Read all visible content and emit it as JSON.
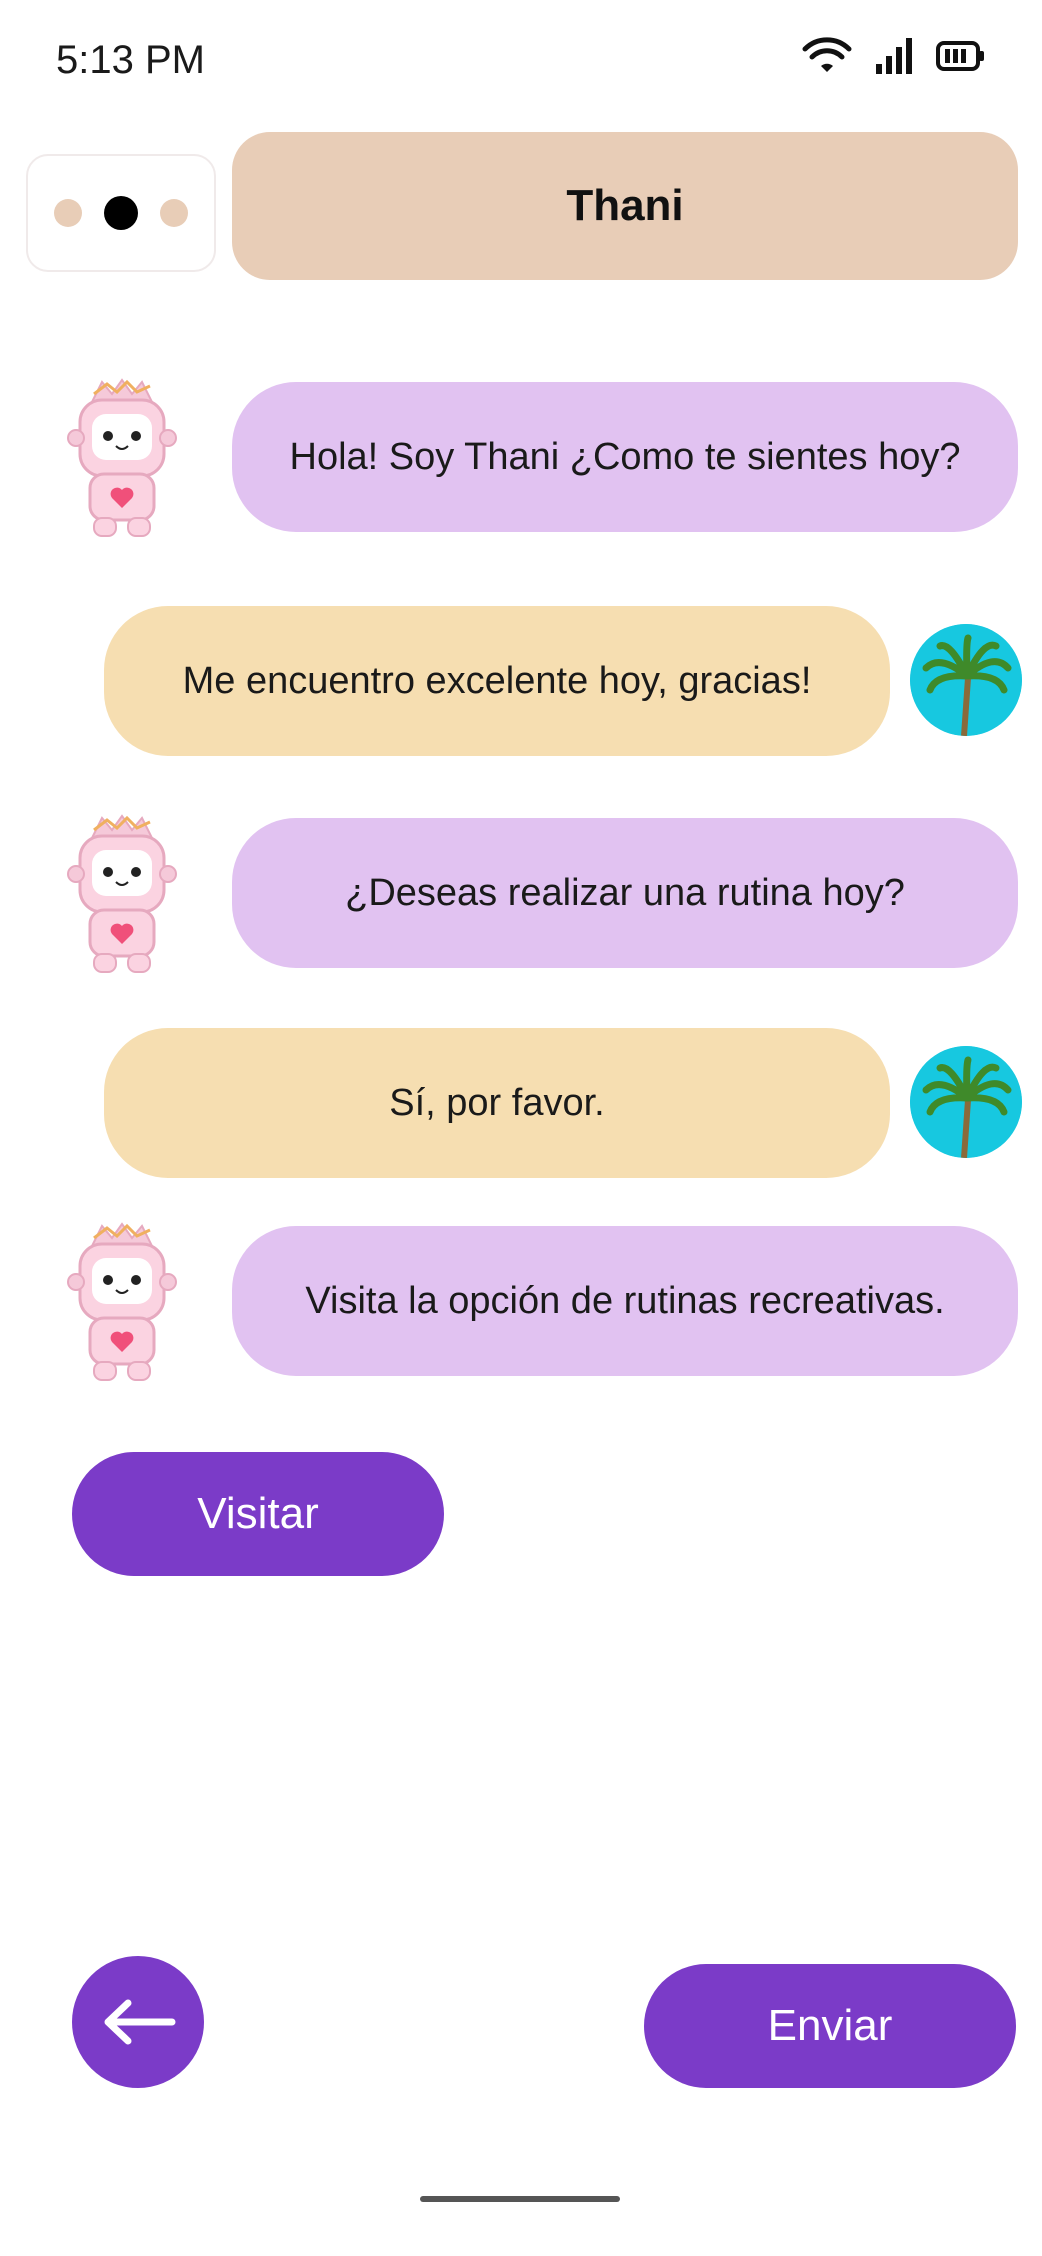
{
  "status_bar": {
    "time": "5:13 PM"
  },
  "header": {
    "title": "Thani"
  },
  "messages": [
    {
      "from": "bot",
      "text": "Hola! Soy Thani ¿Como te sientes hoy?"
    },
    {
      "from": "user",
      "text": "Me encuentro excelente hoy, gracias!"
    },
    {
      "from": "bot",
      "text": "¿Deseas realizar una rutina hoy?"
    },
    {
      "from": "user",
      "text": "Sí, por favor."
    },
    {
      "from": "bot",
      "text": "Visita la opción de rutinas recreativas."
    }
  ],
  "actions": {
    "visit_label": "Visitar",
    "send_label": "Enviar"
  },
  "colors": {
    "accent": "#7b3bc8",
    "bot_bubble": "#e1c2f1",
    "user_bubble": "#f6deb1",
    "header": "#e8cdb7"
  }
}
